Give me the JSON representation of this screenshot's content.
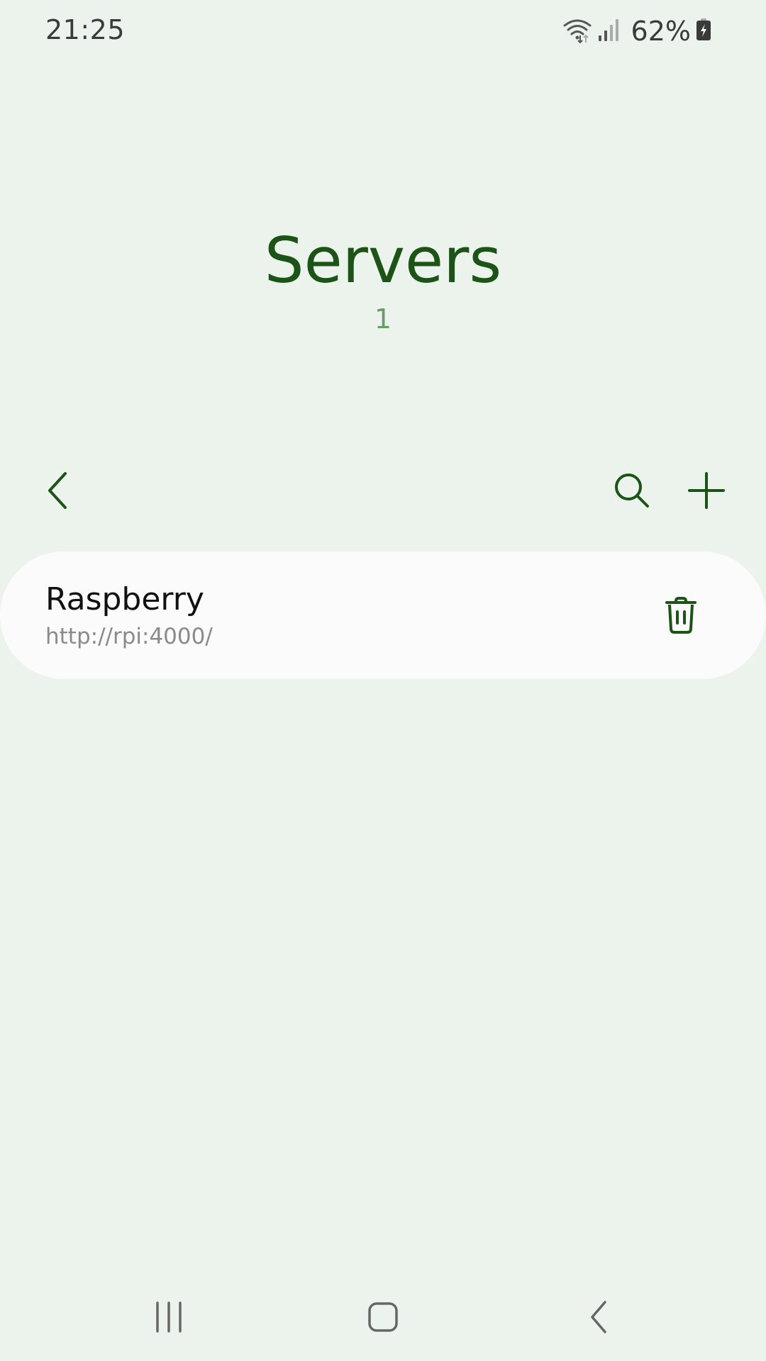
{
  "status_bar": {
    "time": "21:25",
    "battery_percent": "62%",
    "icons": [
      "wifi-icon",
      "signal-icon",
      "battery-charging-icon"
    ]
  },
  "header": {
    "title": "Servers",
    "count": "1"
  },
  "toolbar": {
    "icons": [
      "back-icon",
      "search-icon",
      "add-icon"
    ]
  },
  "servers": [
    {
      "name": "Raspberry",
      "url": "http://rpi:4000/",
      "action_icon": "trash-icon"
    }
  ],
  "nav_bar": {
    "icons": [
      "recents-icon",
      "home-icon",
      "back-icon"
    ]
  },
  "colors": {
    "background": "#ECF3EC",
    "accent": "#1C5417",
    "count": "#6E9A6A",
    "card": "#FBFBFB"
  }
}
